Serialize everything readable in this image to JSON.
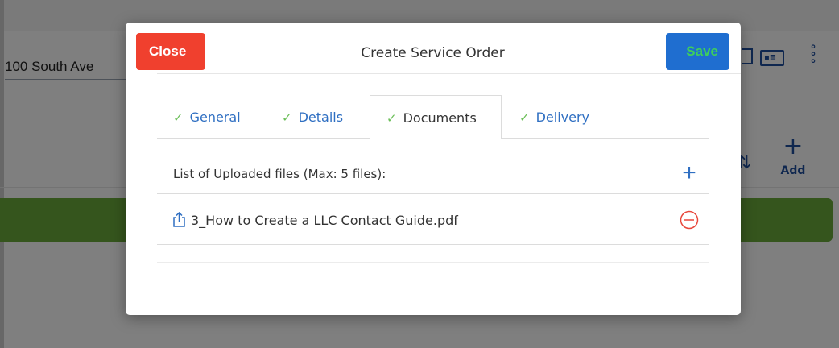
{
  "background": {
    "address_value": "100 South Ave",
    "add_label": "Add",
    "accent_color": "#6aaa3b"
  },
  "modal": {
    "title": "Create Service Order",
    "close_label": "Close",
    "save_label": "Save",
    "close_color": "#f0402e",
    "save_color": "#1f6ed0"
  },
  "tabs": [
    {
      "label": "General",
      "complete": true,
      "active": false
    },
    {
      "label": "Details",
      "complete": true,
      "active": false
    },
    {
      "label": "Documents",
      "complete": true,
      "active": true
    },
    {
      "label": "Delivery",
      "complete": true,
      "active": false
    }
  ],
  "documents": {
    "list_label": "List of Uploaded files (Max: 5 files):",
    "files": [
      {
        "name": "3_How to Create a LLC Contact Guide.pdf",
        "icon": "upload-icon"
      }
    ]
  },
  "icons": {
    "tab_check": "✓",
    "add": "+",
    "more": "8"
  }
}
